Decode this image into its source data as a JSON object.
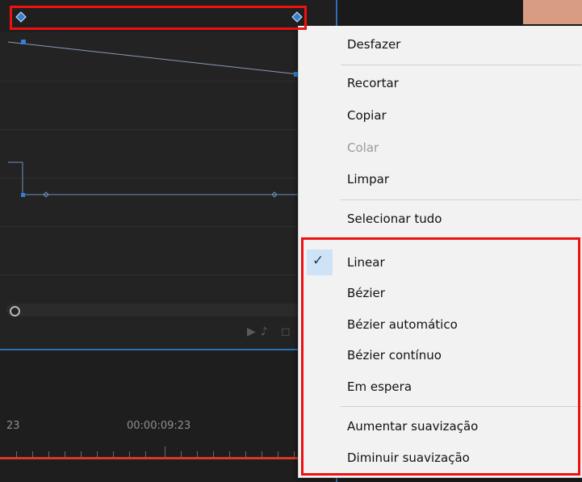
{
  "timeline": {
    "tc_left": "23",
    "tc_center": "00:00:09:23"
  },
  "context_menu": {
    "undo": "Desfazer",
    "cut": "Recortar",
    "copy": "Copiar",
    "paste": "Colar",
    "clear": "Limpar",
    "select_all": "Selecionar tudo",
    "interpolation": {
      "linear": "Linear",
      "bezier": "Bézier",
      "auto_bezier": "Bézier automático",
      "continuous_bezier": "Bézier contínuo",
      "hold": "Em espera"
    },
    "ease_in": "Aumentar suavização",
    "ease_out": "Diminuir suavização",
    "checked_item": "Linear"
  },
  "colors": {
    "highlight": "#ee1111",
    "keyframe": "#2f80d8",
    "accent": "#2d6fb7",
    "playhead": "#d63a2a"
  },
  "icons": {
    "keyframe": "diamond-icon",
    "checkmark": "checkmark-icon",
    "scroll": "circle-handle-icon",
    "transport": "play-audio-icon"
  }
}
